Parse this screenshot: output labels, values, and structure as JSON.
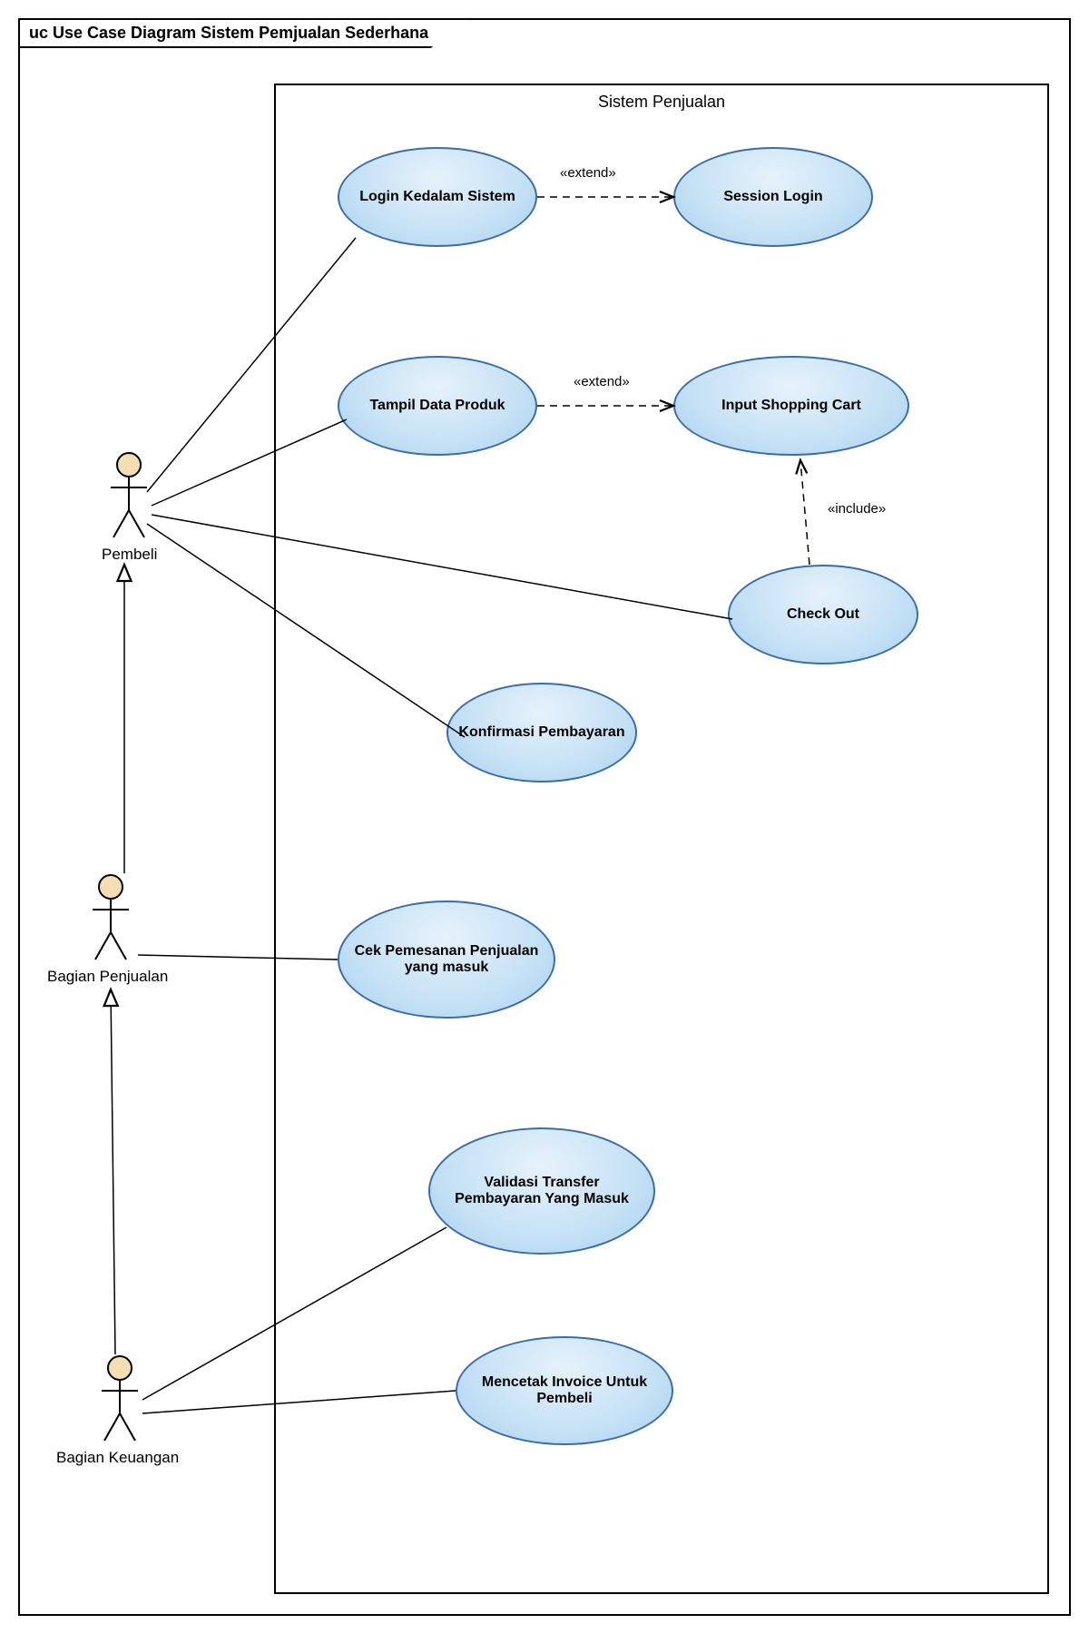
{
  "diagram": {
    "title": "uc Use Case Diagram Sistem Pemjualan Sederhana",
    "system_name": "Sistem Penjualan",
    "actors": {
      "a1": "Pembeli",
      "a2": "Bagian Penjualan",
      "a3": "Bagian Keuangan"
    },
    "usecases": {
      "uc_login": "Login Kedalam Sistem",
      "uc_session": "Session Login",
      "uc_tampil": "Tampil Data Produk",
      "uc_cart": "Input Shopping Cart",
      "uc_checkout": "Check Out",
      "uc_konfirmasi": "Konfirmasi Pembayaran",
      "uc_cek": "Cek Pemesanan Penjualan yang masuk",
      "uc_validasi": "Validasi Transfer Pembayaran Yang Masuk",
      "uc_invoice": "Mencetak Invoice Untuk Pembeli"
    },
    "relations": {
      "extend1": "«extend»",
      "extend2": "«extend»",
      "include1": "«include»"
    }
  }
}
